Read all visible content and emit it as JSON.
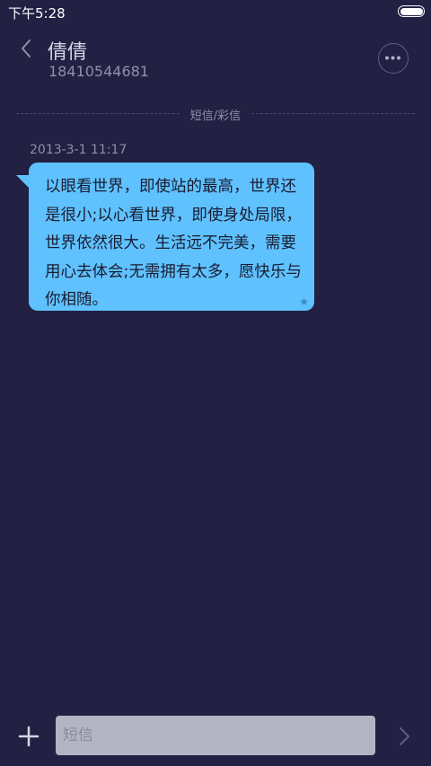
{
  "status_bar": {
    "time": "下午5:28",
    "battery_level": 1.0
  },
  "header": {
    "contact_name": "倩倩",
    "contact_number": "18410544681",
    "back_icon": "chevron-left-icon",
    "more_icon": "more-horizontal-icon"
  },
  "divider": {
    "label": "短信/彩信"
  },
  "messages": [
    {
      "timestamp": "2013-3-1 11:17",
      "text": "以眼看世界，即使站的最高，世界还是很小;以心看世界，即使身处局限，世界依然很大。生活远不完美，需要用心去体会;无需拥有太多，愿快乐与你相随。",
      "star_icon": "star-icon",
      "color": "#5fc2fe"
    }
  ],
  "composer": {
    "placeholder": "短信",
    "add_icon": "plus-icon",
    "send_icon": "chevron-right-icon"
  },
  "colors": {
    "background": "#222043",
    "bubble": "#5fc2fe",
    "input": "#b4b4c4"
  }
}
